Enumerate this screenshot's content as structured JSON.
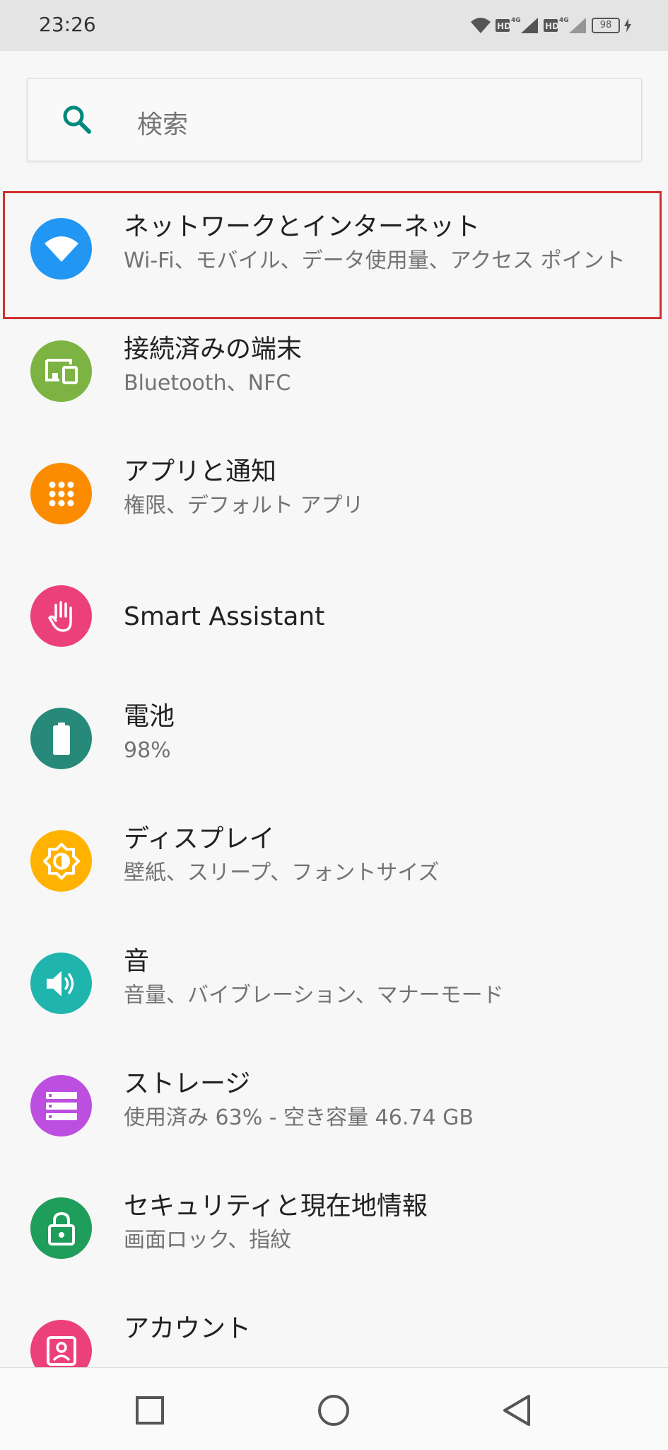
{
  "status_bar": {
    "time": "23:26",
    "battery_level": "98",
    "icons": [
      "wifi-icon",
      "hd-4g-signal-icon",
      "hd-4g-signal-icon",
      "battery-icon",
      "charging-icon"
    ]
  },
  "search": {
    "placeholder": "検索",
    "icon": "search-icon"
  },
  "settings": [
    {
      "title": "ネットワークとインターネット",
      "subtitle": "Wi-Fi、モバイル、データ使用量、アクセス ポイント",
      "icon": "wifi-icon",
      "color": "#2196f3"
    },
    {
      "title": "接続済みの端末",
      "subtitle": "Bluetooth、NFC",
      "icon": "devices-icon",
      "color": "#7cb342"
    },
    {
      "title": "アプリと通知",
      "subtitle": "権限、デフォルト アプリ",
      "icon": "apps-grid-icon",
      "color": "#fb8c00"
    },
    {
      "title": "Smart Assistant",
      "subtitle": "",
      "icon": "hand-icon",
      "color": "#ec407a"
    },
    {
      "title": "電池",
      "subtitle": "98%",
      "icon": "battery-icon",
      "color": "#26897a"
    },
    {
      "title": "ディスプレイ",
      "subtitle": "壁紙、スリープ、フォントサイズ",
      "icon": "brightness-icon",
      "color": "#ffb300"
    },
    {
      "title": "音",
      "subtitle": "音量、バイブレーション、マナーモード",
      "icon": "volume-icon",
      "color": "#1fb5ad"
    },
    {
      "title": "ストレージ",
      "subtitle": "使用済み 63% - 空き容量 46.74 GB",
      "icon": "storage-icon",
      "color": "#bd4fe0"
    },
    {
      "title": "セキュリティと現在地情報",
      "subtitle": "画面ロック、指紋",
      "icon": "lock-icon",
      "color": "#1e9e5a"
    },
    {
      "title": "アカウント",
      "subtitle": "",
      "icon": "account-icon",
      "color": "#ec407a"
    }
  ],
  "nav_bar": {
    "buttons": [
      "recents-icon",
      "home-icon",
      "back-icon"
    ]
  }
}
